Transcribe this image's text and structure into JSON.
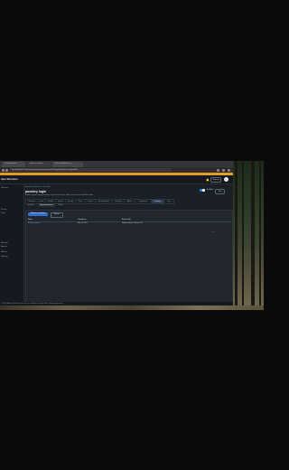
{
  "browser": {
    "tabs": [
      {
        "label": "Console Home"
      },
      {
        "label": "Amazon Connect"
      },
      {
        "label": "Secure Web Access"
      }
    ],
    "url": "ap-southeast-2.console.aws.amazon.com/connect/v2/app/settings/security-profiles"
  },
  "console": {
    "logo": "aws Services",
    "region": "Sydney",
    "bell": "🔔"
  },
  "sidebar": {
    "items": [
      "Services",
      "Phone",
      "Chat",
      "Routing",
      "Agents",
      "Metrics",
      "Settings"
    ]
  },
  "main": {
    "breadcrumb": "Amazon Connect  >  Security",
    "title": "passkey login",
    "description": "Enable sign-in using passkeys on your devices for faster, more secure authentication",
    "toggle_label": "Enabled",
    "help_button": "Info",
    "tabs": [
      "Overview",
      "Users",
      "Profiles",
      "Queues",
      "Routing",
      "Flows",
      "Contact",
      "Security profiles",
      "Channels",
      "Metrics",
      "Integrations",
      "Passkeys",
      "Data"
    ],
    "selected_tab": "Passkeys",
    "subtabs": [
      "Overview",
      "Registered devices",
      "Policies"
    ],
    "selected_subtab": "Registered devices",
    "primary_button": "Register new passkey",
    "secondary_button": "Remove",
    "columns": [
      "Name",
      "Created on",
      "Device info"
    ],
    "rows": [
      {
        "name": "Primary passkey",
        "created": "Mar 14, 2024",
        "device": "Windows Hello, Chrome 122"
      }
    ],
    "pager": "< 1 >",
    "footer": "© 2024, Amazon Web Services, Inc. or its affiliates.  Privacy  Terms  Cookie preferences"
  },
  "colors": {
    "accent": "#2f7de1",
    "header_bar": "#e39c25",
    "background": "#0a0a0a"
  }
}
